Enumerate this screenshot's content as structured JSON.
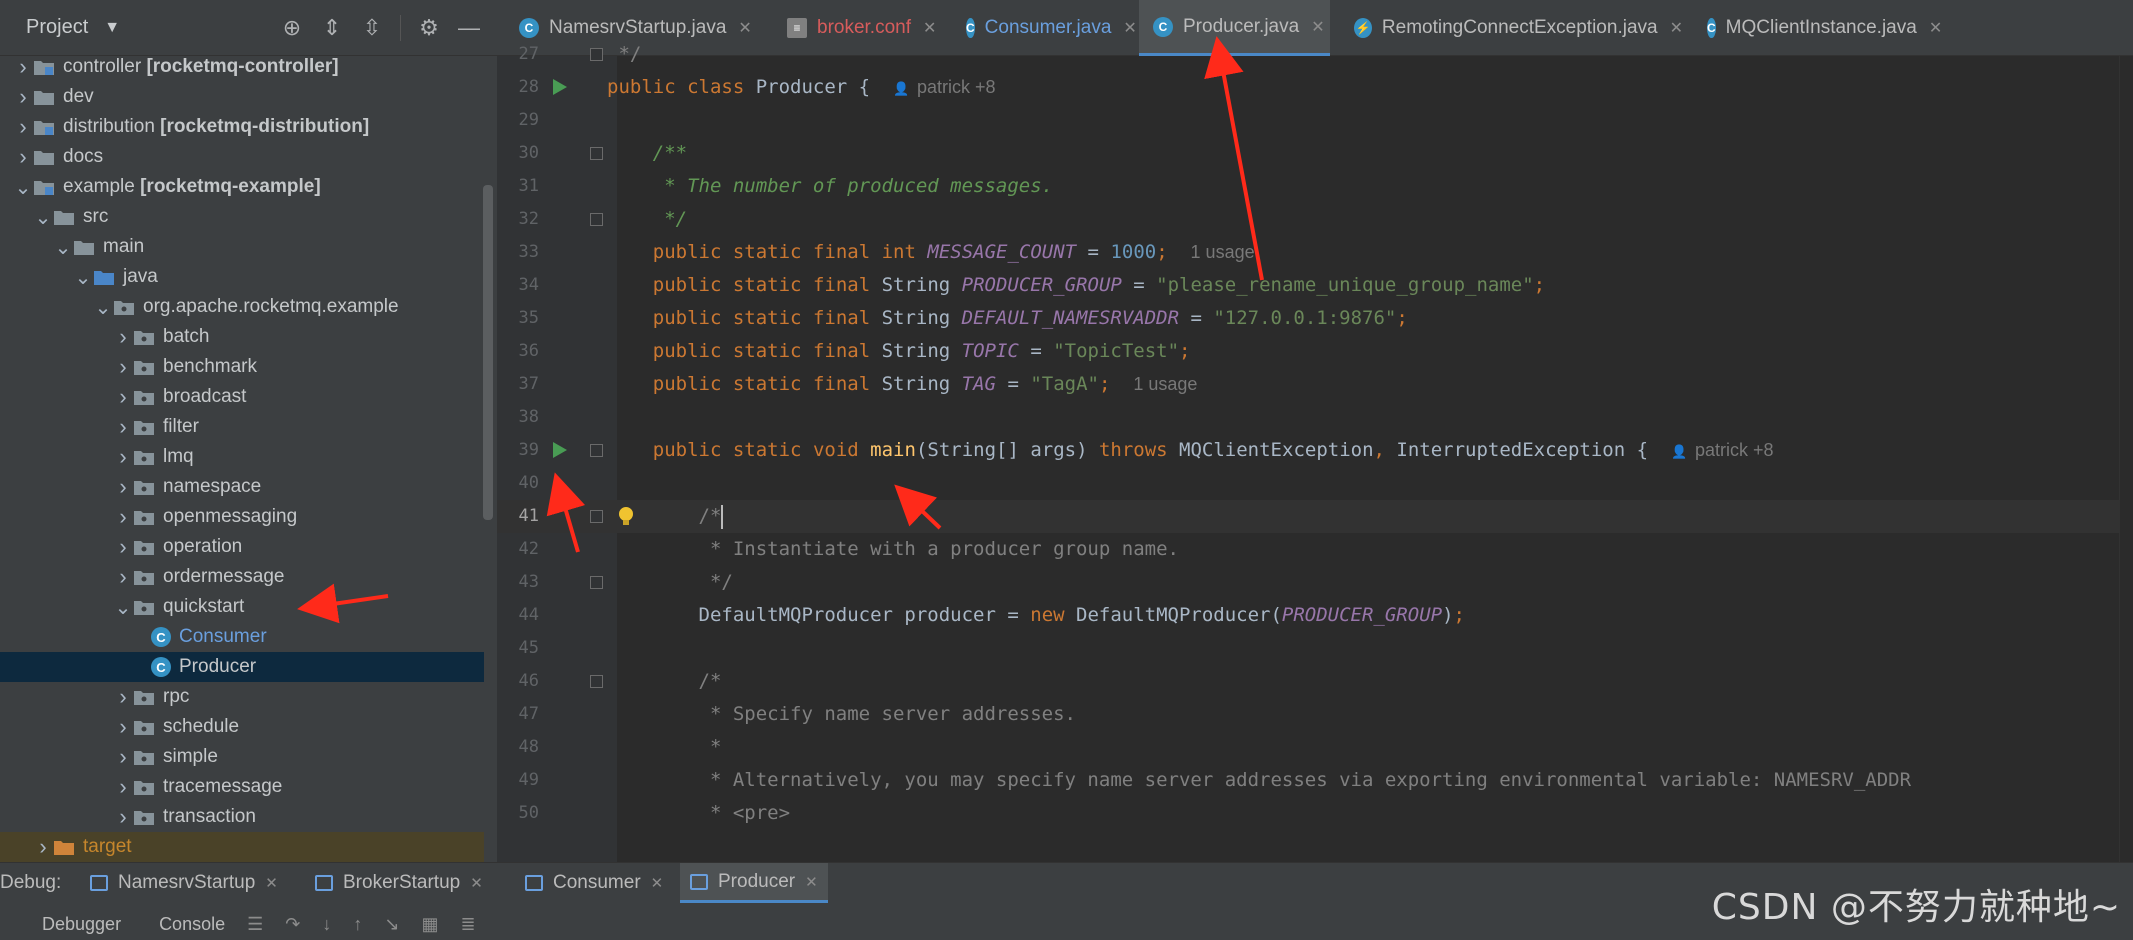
{
  "project_panel": {
    "title": "Project",
    "tree": [
      {
        "label": "controller",
        "module": "[rocketmq-controller]",
        "type": "module",
        "expanded": false
      },
      {
        "label": "dev",
        "type": "folder",
        "expanded": false
      },
      {
        "label": "distribution",
        "module": "[rocketmq-distribution]",
        "type": "module",
        "expanded": false
      },
      {
        "label": "docs",
        "type": "folder",
        "expanded": false
      },
      {
        "label": "example",
        "module": "[rocketmq-example]",
        "type": "module",
        "expanded": true
      },
      {
        "label": "src",
        "type": "folder",
        "expanded": true
      },
      {
        "label": "main",
        "type": "folder",
        "expanded": true
      },
      {
        "label": "java",
        "type": "source",
        "expanded": true
      },
      {
        "label": "org.apache.rocketmq.example",
        "type": "package",
        "expanded": true
      },
      {
        "label": "batch",
        "type": "package",
        "expanded": false
      },
      {
        "label": "benchmark",
        "type": "package",
        "expanded": false
      },
      {
        "label": "broadcast",
        "type": "package",
        "expanded": false
      },
      {
        "label": "filter",
        "type": "package",
        "expanded": false
      },
      {
        "label": "lmq",
        "type": "package",
        "expanded": false
      },
      {
        "label": "namespace",
        "type": "package",
        "expanded": false
      },
      {
        "label": "openmessaging",
        "type": "package",
        "expanded": false
      },
      {
        "label": "operation",
        "type": "package",
        "expanded": false
      },
      {
        "label": "ordermessage",
        "type": "package",
        "expanded": false
      },
      {
        "label": "quickstart",
        "type": "package",
        "expanded": true
      },
      {
        "label": "Consumer",
        "type": "class"
      },
      {
        "label": "Producer",
        "type": "class",
        "selected": true
      },
      {
        "label": "rpc",
        "type": "package",
        "expanded": false
      },
      {
        "label": "schedule",
        "type": "package",
        "expanded": false
      },
      {
        "label": "simple",
        "type": "package",
        "expanded": false
      },
      {
        "label": "tracemessage",
        "type": "package",
        "expanded": false
      },
      {
        "label": "transaction",
        "type": "package",
        "expanded": false
      },
      {
        "label": "target",
        "type": "excluded",
        "expanded": false
      }
    ]
  },
  "editor_tabs": [
    {
      "label": "NamesrvStartup.java",
      "icon": "java-class-icon"
    },
    {
      "label": "broker.conf",
      "icon": "config-file-icon"
    },
    {
      "label": "Consumer.java",
      "icon": "java-class-icon"
    },
    {
      "label": "Producer.java",
      "icon": "java-class-icon",
      "active": true
    },
    {
      "label": "RemotingConnectException.java",
      "icon": "exception-class-icon"
    },
    {
      "label": "MQClientInstance.java",
      "icon": "java-class-icon"
    }
  ],
  "code_lines": [
    {
      "n": "27",
      "text": " */"
    },
    {
      "n": "28",
      "text": "public class Producer {",
      "hint": "patrick +8"
    },
    {
      "n": "29",
      "text": ""
    },
    {
      "n": "30",
      "text": "    /**"
    },
    {
      "n": "31",
      "text": "     * The number of produced messages."
    },
    {
      "n": "32",
      "text": "     */"
    },
    {
      "n": "33",
      "text": "    public static final int MESSAGE_COUNT = 1000;",
      "hint": "1 usage"
    },
    {
      "n": "34",
      "text": "    public static final String PRODUCER_GROUP = \"please_rename_unique_group_name\";"
    },
    {
      "n": "35",
      "text": "    public static final String DEFAULT_NAMESRVADDR = \"127.0.0.1:9876\";"
    },
    {
      "n": "36",
      "text": "    public static final String TOPIC = \"TopicTest\";"
    },
    {
      "n": "37",
      "text": "    public static final String TAG = \"TagA\";",
      "hint": "1 usage"
    },
    {
      "n": "38",
      "text": ""
    },
    {
      "n": "39",
      "text": "    public static void main(String[] args) throws MQClientException, InterruptedException {",
      "hint": "patrick +8"
    },
    {
      "n": "40",
      "text": ""
    },
    {
      "n": "41",
      "text": "        /*"
    },
    {
      "n": "42",
      "text": "         * Instantiate with a producer group name."
    },
    {
      "n": "43",
      "text": "         */"
    },
    {
      "n": "44",
      "text": "        DefaultMQProducer producer = new DefaultMQProducer(PRODUCER_GROUP);"
    },
    {
      "n": "45",
      "text": ""
    },
    {
      "n": "46",
      "text": "        /*"
    },
    {
      "n": "47",
      "text": "         * Specify name server addresses."
    },
    {
      "n": "48",
      "text": "         *"
    },
    {
      "n": "49",
      "text": "         * Alternatively, you may specify name server addresses via exporting environmental variable: NAMESRV_ADDR"
    },
    {
      "n": "50",
      "text": "         * <pre>"
    }
  ],
  "debug_panel": {
    "label": "Debug:",
    "tabs": [
      {
        "label": "NamesrvStartup"
      },
      {
        "label": "BrokerStartup"
      },
      {
        "label": "Consumer"
      },
      {
        "label": "Producer",
        "active": true
      }
    ],
    "subtabs": [
      "Debugger",
      "Console"
    ]
  },
  "watermark": "CSDN @不努力就种地~",
  "colors": {
    "accent": "#4a88c7",
    "arrow": "#ff2a1a",
    "selection": "#0d293e",
    "run": "#499c54"
  }
}
